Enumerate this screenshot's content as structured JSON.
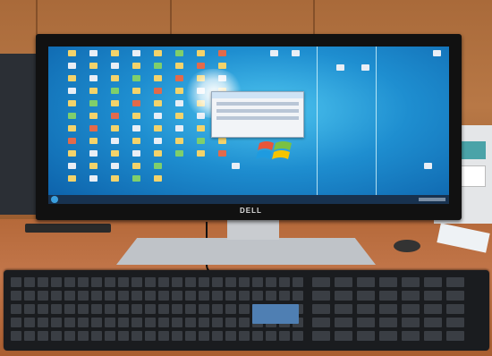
{
  "photo": {
    "subject": "desktop-computer",
    "monitor_brand": "DELL",
    "screen_os_logo": "windows-logo"
  },
  "colors": {
    "desktop_background": "#1e8ed0",
    "taskbar": "#18324f",
    "wood": "#b87846"
  }
}
